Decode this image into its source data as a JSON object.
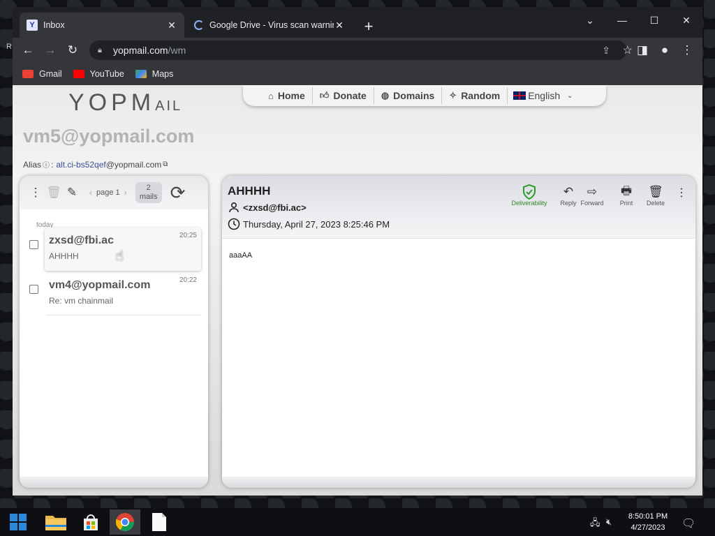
{
  "desktop": {
    "letter": "R"
  },
  "browser": {
    "tabs": [
      {
        "title": "Inbox",
        "favicon": "Y",
        "active": true
      },
      {
        "title": "Google Drive - Virus scan warnin",
        "favicon": "loading-spinner",
        "active": false
      }
    ],
    "url_host": "yopmail.com",
    "url_path": "/wm",
    "bookmarks": [
      {
        "label": "Gmail",
        "icon": "gmail-icon",
        "color": "#ea4335"
      },
      {
        "label": "YouTube",
        "icon": "youtube-icon",
        "color": "#ff0000"
      },
      {
        "label": "Maps",
        "icon": "maps-icon",
        "color": "#34a853"
      }
    ]
  },
  "site": {
    "logo_main": "YOPM",
    "logo_tail": "AIL",
    "nav": [
      {
        "label": "Home",
        "icon": "home-icon"
      },
      {
        "label": "Donate",
        "icon": "thumbs-up-icon"
      },
      {
        "label": "Domains",
        "icon": "globe-icon"
      },
      {
        "label": "Random",
        "icon": "magic-wand-icon"
      }
    ],
    "language": "English",
    "account_email": "vm5@yopmail.com",
    "alias_label": "Alias",
    "alias_value": "alt.ci-bs52qef",
    "alias_domain": "@yopmail.com"
  },
  "inbox": {
    "page_label": "page 1",
    "mail_count": "2",
    "mail_count_unit": "mails",
    "group_label": "today",
    "mails": [
      {
        "from": "zxsd@fbi.ac",
        "subject": "AHHHH",
        "time": "20:25",
        "selected": true
      },
      {
        "from": "vm4@yopmail.com",
        "subject": "Re: vm chainmail",
        "time": "20:22",
        "selected": false
      }
    ]
  },
  "message": {
    "subject": "AHHHH",
    "from": "<zxsd@fbi.ac>",
    "date": "Thursday, April 27, 2023 8:25:46 PM",
    "body": "aaaAA",
    "actions": {
      "deliverability": "Deliverability",
      "reply": "Reply",
      "forward": "Forward",
      "print": "Print",
      "delete": "Delete"
    },
    "deliverability_color": "#2a9a2a"
  },
  "taskbar": {
    "time": "8:50:01 PM",
    "date": "4/27/2023"
  }
}
